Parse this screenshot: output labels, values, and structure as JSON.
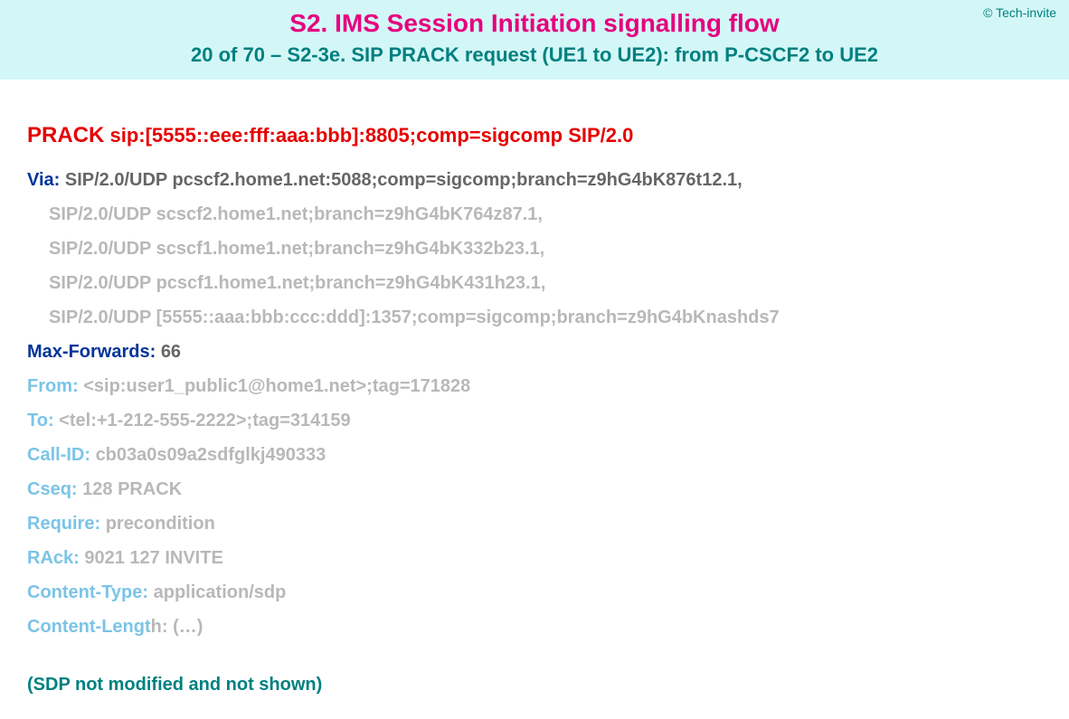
{
  "copyright": "© Tech-invite",
  "title": "S2. IMS Session Initiation signalling flow",
  "subtitle": "20 of 70 – S2-3e. SIP PRACK request (UE1 to UE2): from P-CSCF2 to UE2",
  "request": {
    "method": "PRACK",
    "uri": "sip:[5555::eee:fff:aaa:bbb]:8805;comp=sigcomp SIP/2.0"
  },
  "headers": {
    "via_label": "Via:",
    "via_first": "SIP/2.0/UDP pcscf2.home1.net:5088;comp=sigcomp;branch=z9hG4bK876t12.1,",
    "via_rest": [
      "SIP/2.0/UDP scscf2.home1.net;branch=z9hG4bK764z87.1,",
      "SIP/2.0/UDP scscf1.home1.net;branch=z9hG4bK332b23.1,",
      "SIP/2.0/UDP pcscf1.home1.net;branch=z9hG4bK431h23.1,",
      "SIP/2.0/UDP [5555::aaa:bbb:ccc:ddd]:1357;comp=sigcomp;branch=z9hG4bKnashds7"
    ],
    "max_forwards_label": "Max-Forwards:",
    "max_forwards_value": "66",
    "from_label": "From:",
    "from_value": "<sip:user1_public1@home1.net>;tag=171828",
    "to_label": "To:",
    "to_value": "<tel:+1-212-555-2222>;tag=314159",
    "call_id_label": "Call-ID:",
    "call_id_value": "cb03a0s09a2sdfglkj490333",
    "cseq_label": "Cseq:",
    "cseq_value": "128 PRACK",
    "require_label": "Require:",
    "require_value": "precondition",
    "rack_label": "RAck:",
    "rack_value": "9021 127 INVITE",
    "content_type_label": "Content-Type:",
    "content_type_value": "application/sdp",
    "content_length_label": "Content-Lengt",
    "content_length_label2": "h:",
    "content_length_value": "(…)"
  },
  "sdp_note": "(SDP not modified and not shown)"
}
